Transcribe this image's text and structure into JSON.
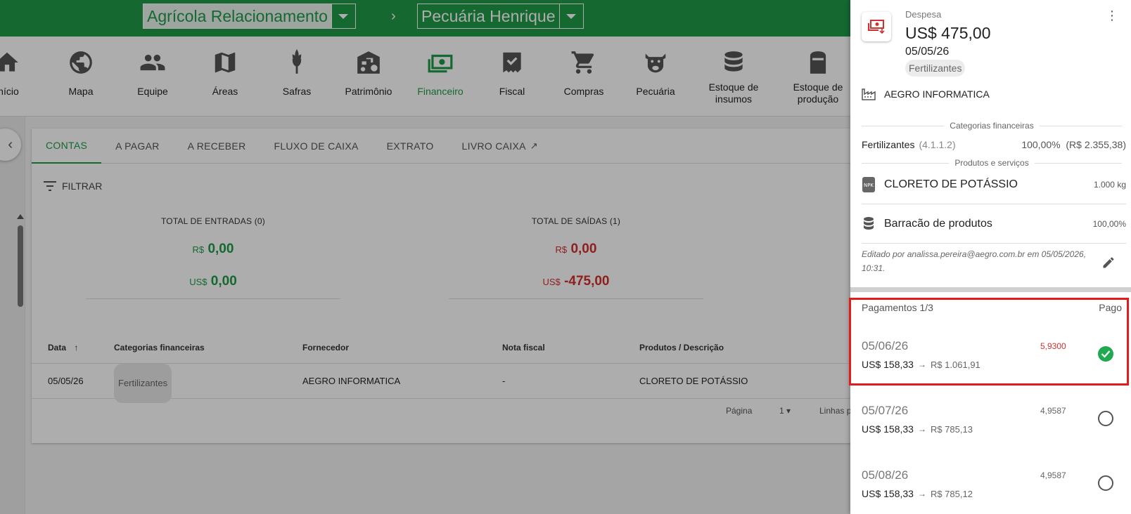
{
  "topbar": {
    "farm_group": "Agrícola Relacionamento",
    "separator": "›",
    "farm": "Pecuária Henrique"
  },
  "modules": [
    {
      "label": "Início",
      "icon": "home-icon"
    },
    {
      "label": "Mapa",
      "icon": "globe-icon"
    },
    {
      "label": "Equipe",
      "icon": "people-icon"
    },
    {
      "label": "Áreas",
      "icon": "map-icon"
    },
    {
      "label": "Safras",
      "icon": "wheat-icon"
    },
    {
      "label": "Patrimônio",
      "icon": "tractor-barn-icon"
    },
    {
      "label": "Financeiro",
      "icon": "cash-icon"
    },
    {
      "label": "Fiscal",
      "icon": "invoice-icon"
    },
    {
      "label": "Compras",
      "icon": "cart-icon"
    },
    {
      "label": "Pecuária",
      "icon": "cow-icon"
    },
    {
      "label": "Estoque de insumos",
      "icon": "database-icon"
    },
    {
      "label": "Estoque de produção",
      "icon": "silo-icon"
    }
  ],
  "tabs": [
    {
      "label": "CONTAS"
    },
    {
      "label": "A PAGAR"
    },
    {
      "label": "A RECEBER"
    },
    {
      "label": "FLUXO DE CAIXA"
    },
    {
      "label": "EXTRATO"
    },
    {
      "label": "LIVRO CAIXA"
    }
  ],
  "filter": {
    "label": "FILTRAR"
  },
  "totals": {
    "inflow": {
      "title": "TOTAL DE ENTRADAS (0)",
      "brl_symbol": "R$",
      "brl": "0,00",
      "usd_symbol": "US$",
      "usd": "0,00"
    },
    "outflow": {
      "title": "TOTAL DE SAÍDAS (1)",
      "brl_symbol": "R$",
      "brl": "0,00",
      "usd_symbol": "US$",
      "usd": "-475,00"
    }
  },
  "table": {
    "headers": {
      "date": "Data",
      "categories": "Categorias financeiras",
      "supplier": "Fornecedor",
      "invoice": "Nota fiscal",
      "products": "Produtos / Descrição"
    },
    "rows": [
      {
        "date": "05/05/26",
        "category": "Fertilizantes",
        "supplier": "AEGRO INFORMATICA",
        "invoice": "-",
        "product": "CLORETO DE POTÁSSIO"
      }
    ],
    "pager": {
      "page_label": "Página",
      "page": "1",
      "rows_label": "Linhas p"
    }
  },
  "drawer": {
    "type": "Despesa",
    "amount": "US$ 475,00",
    "date": "05/05/26",
    "category_chip": "Fertilizantes",
    "supplier": "AEGRO INFORMATICA",
    "fin_section_title": "Categorias financeiras",
    "fin_category": {
      "name": "Fertilizantes",
      "code": "(4.1.1.2)",
      "share": "100,00%",
      "amount": "(R$ 2.355,38)"
    },
    "products_section_title": "Produtos e serviços",
    "product": {
      "name": "CLORETO DE POTÁSSIO",
      "quantity": "1.000 kg"
    },
    "storage": {
      "name": "Barracão de produtos",
      "share": "100,00%"
    },
    "edited_text": "Editado por analissa.pereira@aegro.com.br em 05/05/2026, 10:31.",
    "payments_title": "Pagamentos 1/3",
    "payments_status_label": "Pago",
    "payments": [
      {
        "date": "05/06/26",
        "usd": "US$ 158,33",
        "brl": "R$ 1.061,91",
        "rate": "5,9300",
        "paid": true
      },
      {
        "date": "05/07/26",
        "usd": "US$ 158,33",
        "brl": "R$ 785,13",
        "rate": "4,9587",
        "paid": false
      },
      {
        "date": "05/08/26",
        "usd": "US$ 158,33",
        "brl": "R$ 785,12",
        "rate": "4,9587",
        "paid": false
      }
    ]
  },
  "colors": {
    "brand_green": "#1e9a48",
    "negative_red": "#d32f2f",
    "highlight_red": "#e41b1b"
  }
}
